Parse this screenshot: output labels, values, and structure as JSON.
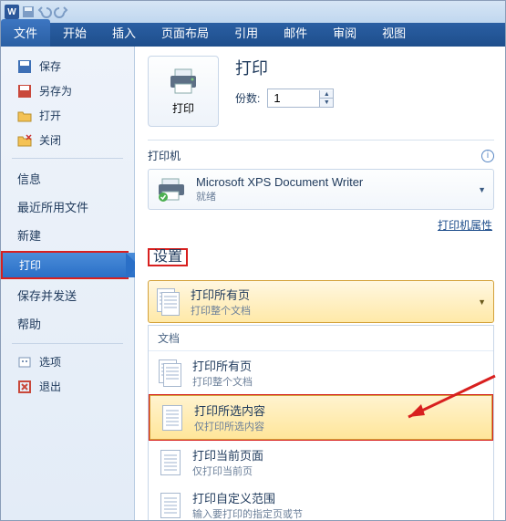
{
  "ribbon": {
    "tabs": [
      "文件",
      "开始",
      "插入",
      "页面布局",
      "引用",
      "邮件",
      "审阅",
      "视图"
    ],
    "active": 0
  },
  "nav": {
    "save": "保存",
    "saveAs": "另存为",
    "open": "打开",
    "close": "关闭",
    "info": "信息",
    "recent": "最近所用文件",
    "new": "新建",
    "print": "打印",
    "saveSend": "保存并发送",
    "help": "帮助",
    "options": "选项",
    "exit": "退出"
  },
  "print": {
    "title": "打印",
    "button": "打印",
    "copiesLabel": "份数:",
    "copiesValue": "1"
  },
  "printer": {
    "heading": "打印机",
    "name": "Microsoft XPS Document Writer",
    "status": "就绪",
    "propsLink": "打印机属性"
  },
  "settings": {
    "heading": "设置",
    "current": {
      "t1": "打印所有页",
      "t2": "打印整个文档"
    },
    "menuSection": "文档",
    "items": [
      {
        "t1": "打印所有页",
        "t2": "打印整个文档"
      },
      {
        "t1": "打印所选内容",
        "t2": "仅打印所选内容"
      },
      {
        "t1": "打印当前页面",
        "t2": "仅打印当前页"
      },
      {
        "t1": "打印自定义范围",
        "t2": "输入要打印的指定页或节"
      }
    ]
  }
}
